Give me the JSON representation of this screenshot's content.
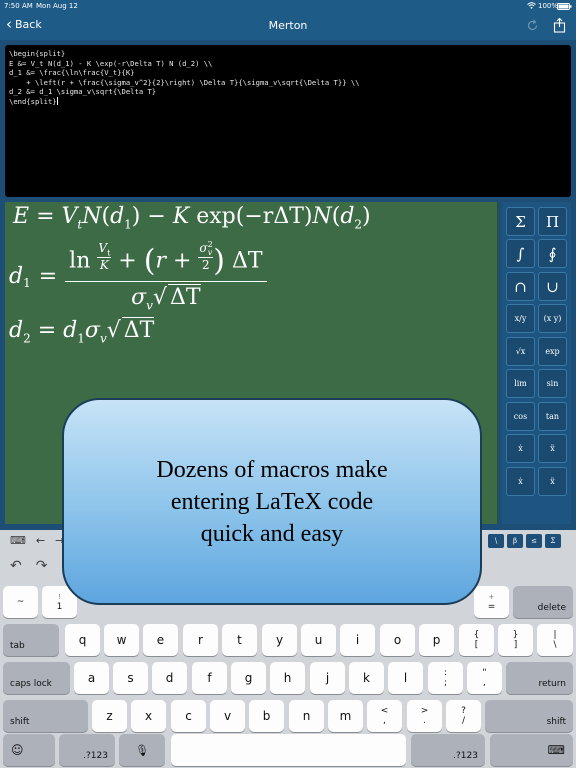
{
  "status": {
    "time": "7:50 AM",
    "date": "Mon Aug 12",
    "battery": "100%"
  },
  "nav": {
    "back_label": "Back",
    "title": "Merton",
    "refresh_icon": "refresh-icon",
    "share_icon": "share-icon"
  },
  "editor": {
    "code": "\\begin{split}\nE &= V_t N(d_1) - K \\exp(-r\\Delta T) N (d_2) \\\\\nd_1 &= \\frac{\\ln\\frac{V_t}{K}\n    + \\left(r + \\frac{\\sigma_v^2}{2}\\right) \\Delta T}{\\sigma_v\\sqrt{\\Delta T}} \\\\\nd_2 &= d_1 \\sigma_v\\sqrt{\\Delta T}\n\\end{split}"
  },
  "rendered": {
    "e_lhs": "E",
    "eq": "=",
    "vt": "V",
    "vt_sub": "t",
    "N": "N",
    "d1": "d",
    "d1_sub": "1",
    "minus": " − ",
    "K": "K",
    "exp": "exp",
    "minus_r": "(−r",
    "delta_t": "ΔT",
    ")": ")",
    "d2": "d",
    "d2_sub": "2",
    "ln": "ln",
    "frac_vt": "V",
    "frac_vt_sub": "t",
    "frac_k": "K",
    "plus": "+",
    "r": "r",
    "plus2": " + ",
    "sigma": "σ",
    "sigma_sub": "v",
    "sigma_sup": "2",
    "two": "2",
    "sqrt_delta_t": "ΔT"
  },
  "palette": {
    "buttons": [
      "Σ",
      "Π",
      "∫",
      "∮",
      "∩",
      "∪",
      "x/y",
      "(x y)",
      "√x",
      "exp",
      "lim",
      "sin",
      "cos",
      "tan",
      "ẋ",
      "ẍ",
      "ẋ",
      "ẍ"
    ]
  },
  "accessory": {
    "left": [
      "⌨",
      "←",
      "→"
    ],
    "right": [
      "\\",
      "β",
      "≤",
      "Σ"
    ]
  },
  "keyboard": {
    "undo_icon": "undo-icon",
    "redo_icon": "redo-icon",
    "row1": [
      {
        "top": "",
        "bottom": "~"
      },
      {
        "top": "!",
        "bottom": "1"
      },
      {
        "top": "+",
        "bottom": "="
      }
    ],
    "delete": "delete",
    "tab": "tab",
    "row2": [
      "q",
      "w",
      "e",
      "r",
      "t",
      "y",
      "u",
      "i",
      "o",
      "p"
    ],
    "row2_punct": [
      {
        "top": "{",
        "bottom": "["
      },
      {
        "top": "}",
        "bottom": "]"
      },
      {
        "top": "|",
        "bottom": "\\"
      }
    ],
    "caps": "caps lock",
    "row3": [
      "a",
      "s",
      "d",
      "f",
      "g",
      "h",
      "j",
      "k",
      "l"
    ],
    "row3_punct": [
      {
        "top": ":",
        "bottom": ";"
      },
      {
        "top": "\"",
        "bottom": ","
      }
    ],
    "return": "return",
    "shift_left": "shift",
    "row4": [
      "z",
      "x",
      "c",
      "v",
      "b",
      "n",
      "m"
    ],
    "row4_punct": [
      {
        "top": "<",
        "bottom": ","
      },
      {
        "top": ">",
        "bottom": "."
      },
      {
        "top": "?",
        "bottom": "/"
      }
    ],
    "shift_right": "shift",
    "emoji": "☺",
    "num_left": ".?123",
    "mic": "🎙",
    "num_right": ".?123",
    "hide": "⌨"
  },
  "promo": {
    "line1": "Dozens of macros make",
    "line2": "entering LaTeX code",
    "line3": "quick and easy"
  }
}
